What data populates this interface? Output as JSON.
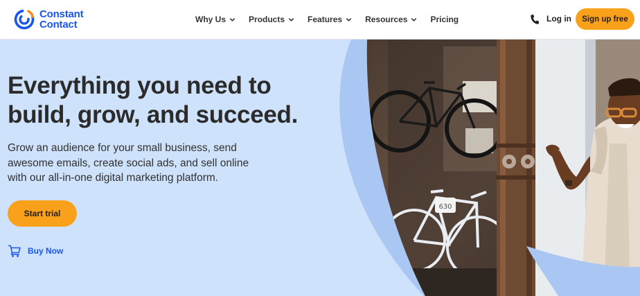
{
  "brand": {
    "name_line1": "Constant",
    "name_line2": "Contact",
    "color": "#1856ED",
    "accent": "#F9A11B"
  },
  "nav": {
    "items": [
      {
        "label": "Why Us",
        "dropdown": true
      },
      {
        "label": "Products",
        "dropdown": true
      },
      {
        "label": "Features",
        "dropdown": true
      },
      {
        "label": "Resources",
        "dropdown": true
      },
      {
        "label": "Pricing",
        "dropdown": false
      }
    ],
    "phone_icon": "phone-icon",
    "login_label": "Log in",
    "signup_label": "Sign up free"
  },
  "hero": {
    "headline_line1": "Everything you need to",
    "headline_line2": "build, grow, and succeed.",
    "subtext": "Grow an audience for your small business, send awesome emails, create social ads, and sell online with our all-in-one digital marketing platform.",
    "start_label": "Start trial",
    "buy_label": "Buy Now",
    "buy_icon": "cart-icon",
    "background": "#CFE2FB"
  },
  "photo": {
    "sign_text": "630"
  }
}
